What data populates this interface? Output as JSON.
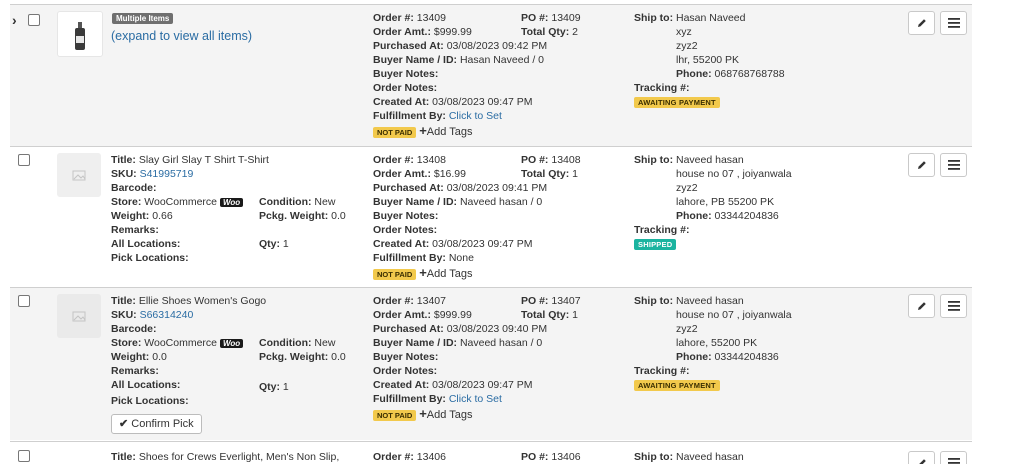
{
  "labels": {
    "order_no": "Order #:",
    "po_no": "PO #:",
    "order_amt": "Order Amt.:",
    "total_qty": "Total Qty:",
    "purchased_at": "Purchased At:",
    "buyer_name": "Buyer Name / ID:",
    "buyer_notes": "Buyer Notes:",
    "order_notes": "Order Notes:",
    "created_at": "Created At:",
    "fulfillment_by": "Fulfillment By:",
    "ship_to": "Ship to:",
    "phone": "Phone:",
    "tracking": "Tracking #:",
    "title": "Title:",
    "sku": "SKU:",
    "barcode": "Barcode:",
    "store": "Store:",
    "condition": "Condition:",
    "weight": "Weight:",
    "pckg_weight": "Pckg. Weight:",
    "remarks": "Remarks:",
    "all_locations": "All Locations:",
    "qty": "Qty:",
    "pick_locations": "Pick Locations:",
    "add_tags": "Add Tags",
    "woo_badge": "Woo",
    "confirm_pick": "Confirm Pick"
  },
  "icons": {
    "expand": "chevron-right-icon",
    "edit": "pencil-icon",
    "menu": "hamburger-menu-icon",
    "add_tags": "plus-icon",
    "confirm": "checkmark-icon",
    "placeholder": "image-placeholder-icon"
  },
  "colors": {
    "link": "#2a6ca3",
    "awaiting_payment": "#f2c94c",
    "shipped": "#1bb4a0",
    "not_paid": "#f2c94c"
  },
  "orders": [
    {
      "multi_badge": "Multiple Items",
      "expand_text": "(expand to view all items)",
      "order_no": "13409",
      "po_no": "13409",
      "order_amt": "$999.99",
      "total_qty": "2",
      "purchased_at": "03/08/2023 09:42 PM",
      "buyer": "Hasan Naveed / 0",
      "created_at": "03/08/2023 09:47 PM",
      "fulfillment": "Click to Set",
      "payment": "NOT PAID",
      "ship_name": "Hasan Naveed",
      "addr1": "xyz",
      "addr2": "zyz2",
      "addr3": "lhr,   55200 PK",
      "phone": "068768768788",
      "tracking_status": "AWAITING PAYMENT"
    },
    {
      "title": "Slay Girl Slay T Shirt T-Shirt",
      "sku": "S41995719",
      "store": "WooCommerce",
      "condition": "New",
      "weight": "0.66",
      "pckg_weight": "0.0",
      "qty": "1",
      "order_no": "13408",
      "po_no": "13408",
      "order_amt": "$16.99",
      "total_qty": "1",
      "purchased_at": "03/08/2023 09:41 PM",
      "buyer": "Naveed hasan / 0",
      "created_at": "03/08/2023 09:47 PM",
      "fulfillment": "None",
      "payment": "NOT PAID",
      "ship_name": "Naveed hasan",
      "addr1": "house no 07 , joiyanwala",
      "addr2": "zyz2",
      "addr3": "lahore, PB  55200 PK",
      "phone": "03344204836",
      "tracking_status": "SHIPPED"
    },
    {
      "title": "Ellie Shoes Women's Gogo",
      "sku": "S66314240",
      "store": "WooCommerce",
      "condition": "New",
      "weight": "0.0",
      "pckg_weight": "0.0",
      "qty": "1",
      "order_no": "13407",
      "po_no": "13407",
      "order_amt": "$999.99",
      "total_qty": "1",
      "purchased_at": "03/08/2023 09:40 PM",
      "buyer": "Naveed hasan / 0",
      "created_at": "03/08/2023 09:47 PM",
      "fulfillment": "Click to Set",
      "payment": "NOT PAID",
      "ship_name": "Naveed hasan",
      "addr1": "house no 07 , joiyanwala",
      "addr2": "zyz2",
      "addr3": "lahore,   55200 PK",
      "phone": "03344204836",
      "tracking_status": "AWAITING PAYMENT"
    },
    {
      "title": "Shoes for Crews Everlight, Men's Non Slip,",
      "order_no": "13406",
      "po_no": "13406",
      "ship_name": "Naveed hasan"
    }
  ]
}
